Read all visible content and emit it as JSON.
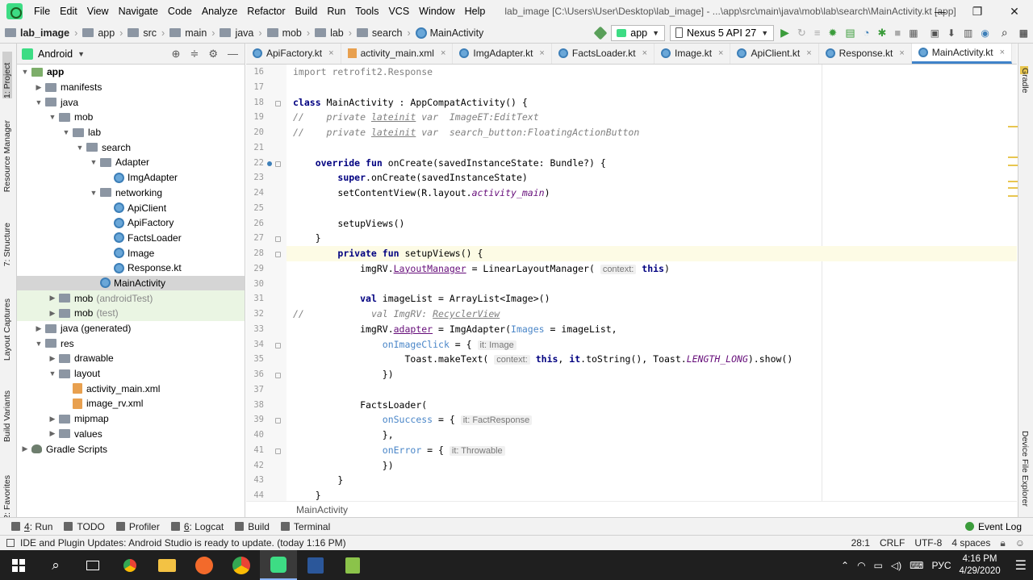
{
  "window": {
    "title": "lab_image [C:\\Users\\User\\Desktop\\lab_image] - ...\\app\\src\\main\\java\\mob\\lab\\search\\MainActivity.kt [app]",
    "menu": [
      "File",
      "Edit",
      "View",
      "Navigate",
      "Code",
      "Analyze",
      "Refactor",
      "Build",
      "Run",
      "Tools",
      "VCS",
      "Window",
      "Help"
    ],
    "controls": [
      "—",
      "❐",
      "✕"
    ]
  },
  "breadcrumb": [
    "lab_image",
    "app",
    "src",
    "main",
    "java",
    "mob",
    "lab",
    "search",
    "MainActivity"
  ],
  "toolbar": {
    "config": "app",
    "device": "Nexus 5 API 27"
  },
  "left_stripe": [
    "1: Project",
    "Resource Manager",
    "7: Structure",
    "Layout Captures",
    "Build Variants",
    "2: Favorites"
  ],
  "right_stripe": [
    "Gradle",
    "Device File Explorer"
  ],
  "project_panel": {
    "title": "Android",
    "tree": [
      {
        "label": "app",
        "bold": true,
        "icon": "module",
        "arrow": "▼",
        "indent": 0
      },
      {
        "label": "manifests",
        "icon": "folder",
        "arrow": "▶",
        "indent": 1
      },
      {
        "label": "java",
        "icon": "folder",
        "arrow": "▼",
        "indent": 1
      },
      {
        "label": "mob",
        "icon": "package",
        "arrow": "▼",
        "indent": 2
      },
      {
        "label": "lab",
        "icon": "package",
        "arrow": "▼",
        "indent": 3
      },
      {
        "label": "search",
        "icon": "package",
        "arrow": "▼",
        "indent": 4
      },
      {
        "label": "Adapter",
        "icon": "package",
        "arrow": "▼",
        "indent": 5
      },
      {
        "label": "ImgAdapter",
        "icon": "kotlin",
        "arrow": "",
        "indent": 6
      },
      {
        "label": "networking",
        "icon": "package",
        "arrow": "▼",
        "indent": 5
      },
      {
        "label": "ApiClient",
        "icon": "kotlin",
        "arrow": "",
        "indent": 6
      },
      {
        "label": "ApiFactory",
        "icon": "kotlin",
        "arrow": "",
        "indent": 6
      },
      {
        "label": "FactsLoader",
        "icon": "kotlin",
        "arrow": "",
        "indent": 6
      },
      {
        "label": "Image",
        "icon": "kotlin",
        "arrow": "",
        "indent": 6
      },
      {
        "label": "Response.kt",
        "icon": "kotlin",
        "arrow": "",
        "indent": 6
      },
      {
        "label": "MainActivity",
        "icon": "kotlin",
        "arrow": "",
        "indent": 5,
        "selected": true
      },
      {
        "label": "mob",
        "suffix": "(androidTest)",
        "icon": "package",
        "arrow": "▶",
        "indent": 2,
        "green": true
      },
      {
        "label": "mob",
        "suffix": "(test)",
        "icon": "package",
        "arrow": "▶",
        "indent": 2,
        "green": true
      },
      {
        "label": "java (generated)",
        "icon": "folder",
        "arrow": "▶",
        "indent": 1
      },
      {
        "label": "res",
        "icon": "folder",
        "arrow": "▼",
        "indent": 1
      },
      {
        "label": "drawable",
        "icon": "folder",
        "arrow": "▶",
        "indent": 2
      },
      {
        "label": "layout",
        "icon": "folder",
        "arrow": "▼",
        "indent": 2
      },
      {
        "label": "activity_main.xml",
        "icon": "xml",
        "arrow": "",
        "indent": 3
      },
      {
        "label": "image_rv.xml",
        "icon": "xml",
        "arrow": "",
        "indent": 3
      },
      {
        "label": "mipmap",
        "icon": "folder",
        "arrow": "▶",
        "indent": 2
      },
      {
        "label": "values",
        "icon": "folder",
        "arrow": "▶",
        "indent": 2
      },
      {
        "label": "Gradle Scripts",
        "icon": "gradle",
        "arrow": "▶",
        "indent": 0
      }
    ]
  },
  "tabs": [
    {
      "label": "ApiFactory.kt",
      "icon": "kotlin"
    },
    {
      "label": "activity_main.xml",
      "icon": "xml"
    },
    {
      "label": "ImgAdapter.kt",
      "icon": "kotlin"
    },
    {
      "label": "FactsLoader.kt",
      "icon": "kotlin"
    },
    {
      "label": "Image.kt",
      "icon": "kotlin"
    },
    {
      "label": "ApiClient.kt",
      "icon": "kotlin"
    },
    {
      "label": "Response.kt",
      "icon": "kotlin"
    },
    {
      "label": "MainActivity.kt",
      "icon": "kotlin",
      "active": true
    }
  ],
  "code": [
    {
      "n": 16,
      "html": "<span class=\"cm\" style=\"font-style:normal;color:#808080\">import retrofit2.Response</span>"
    },
    {
      "n": 17,
      "html": ""
    },
    {
      "n": 18,
      "html": "<span class=\"kw\">class</span> MainActivity : AppCompatActivity() {"
    },
    {
      "n": 19,
      "html": "<span class=\"cm\">//    private <span class=\"ul\">lateinit</span> var  ImageET:EditText</span>"
    },
    {
      "n": 20,
      "html": "<span class=\"cm\">//    private <span class=\"ul\">lateinit</span> var  search_button:FloatingActionButton</span>"
    },
    {
      "n": 21,
      "html": ""
    },
    {
      "n": 22,
      "html": "    <span class=\"kw\">override fun</span> onCreate(savedInstanceState: Bundle?) {"
    },
    {
      "n": 23,
      "html": "        <span class=\"kw\">super</span>.onCreate(savedInstanceState)"
    },
    {
      "n": 24,
      "html": "        setContentView(R.layout.<span class=\"it\">activity_main</span>)"
    },
    {
      "n": 25,
      "html": ""
    },
    {
      "n": 26,
      "html": "        setupViews()"
    },
    {
      "n": 27,
      "html": "    }"
    },
    {
      "n": 28,
      "html": "        <span class=\"kw\">private fun</span> setupViews() {",
      "current": true
    },
    {
      "n": 29,
      "html": "            imgRV.<span class=\"pr ul\">LayoutManager</span> = LinearLayoutManager( <span class=\"hint\">context:</span> <span class=\"kw\">this</span>)"
    },
    {
      "n": 30,
      "html": ""
    },
    {
      "n": 31,
      "html": "            <span class=\"kw\">val</span> imageList = ArrayList&lt;Image&gt;()"
    },
    {
      "n": 32,
      "html": "<span class=\"cm\">//</span>            <span class=\"cm\">val ImgRV: <span class=\"ul\">RecyclerView</span></span>"
    },
    {
      "n": 33,
      "html": "            imgRV.<span class=\"pr ul\">adapter</span> = ImgAdapter(<span class=\"nm\">Images</span> = imageList,"
    },
    {
      "n": 34,
      "html": "                <span class=\"nm\">onImageClick</span> = { <span class=\"hint\">it: Image</span>"
    },
    {
      "n": 35,
      "html": "                    Toast.makeText( <span class=\"hint\">context:</span> <span class=\"kw\">this</span>, <span class=\"kw\">it</span>.toString(), Toast.<span class=\"it\">LENGTH_LONG</span>).show()"
    },
    {
      "n": 36,
      "html": "                })"
    },
    {
      "n": 37,
      "html": ""
    },
    {
      "n": 38,
      "html": "            FactsLoader("
    },
    {
      "n": 39,
      "html": "                <span class=\"nm\">onSuccess</span> = { <span class=\"hint\">it: FactResponse</span>"
    },
    {
      "n": 40,
      "html": "                },"
    },
    {
      "n": 41,
      "html": "                <span class=\"nm\">onError</span> = { <span class=\"hint\">it: Throwable</span>"
    },
    {
      "n": 42,
      "html": "                })"
    },
    {
      "n": 43,
      "html": "        }"
    },
    {
      "n": 44,
      "html": "    }"
    }
  ],
  "editor_breadcrumb": "MainActivity",
  "bottom_tools": [
    {
      "key": "4",
      "label": ": Run"
    },
    {
      "key": "",
      "label": "TODO"
    },
    {
      "key": "",
      "label": "Profiler"
    },
    {
      "key": "6",
      "label": ": Logcat"
    },
    {
      "key": "",
      "label": "Build"
    },
    {
      "key": "",
      "label": "Terminal"
    }
  ],
  "event_log": "Event Log",
  "status": {
    "message": "IDE and Plugin Updates: Android Studio is ready to update. (today 1:16 PM)",
    "position": "28:1",
    "line_sep": "CRLF",
    "encoding": "UTF-8",
    "indent": "4 spaces"
  },
  "taskbar": {
    "lang": "РУС",
    "time": "4:16 PM",
    "date": "4/29/2020"
  }
}
